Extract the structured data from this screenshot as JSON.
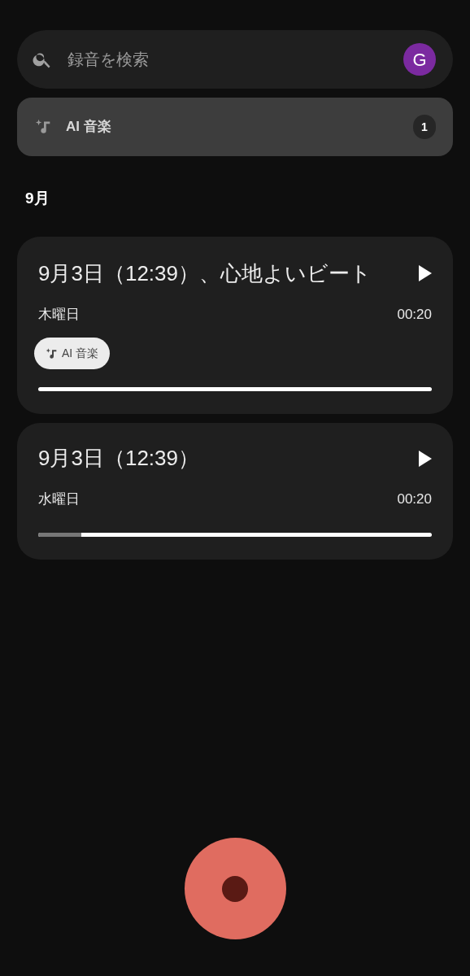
{
  "search": {
    "placeholder": "録音を検索",
    "avatar": "G"
  },
  "filter": {
    "label": "AI 音楽",
    "count": "1"
  },
  "section": "9月",
  "recordings": [
    {
      "title": "9月3日（12:39）、心地よいビート",
      "day": "木曜日",
      "duration": "00:20",
      "tag": "AI 音楽",
      "level": 0
    },
    {
      "title": "9月3日（12:39）",
      "day": "水曜日",
      "duration": "00:20",
      "level": 0.11
    }
  ]
}
